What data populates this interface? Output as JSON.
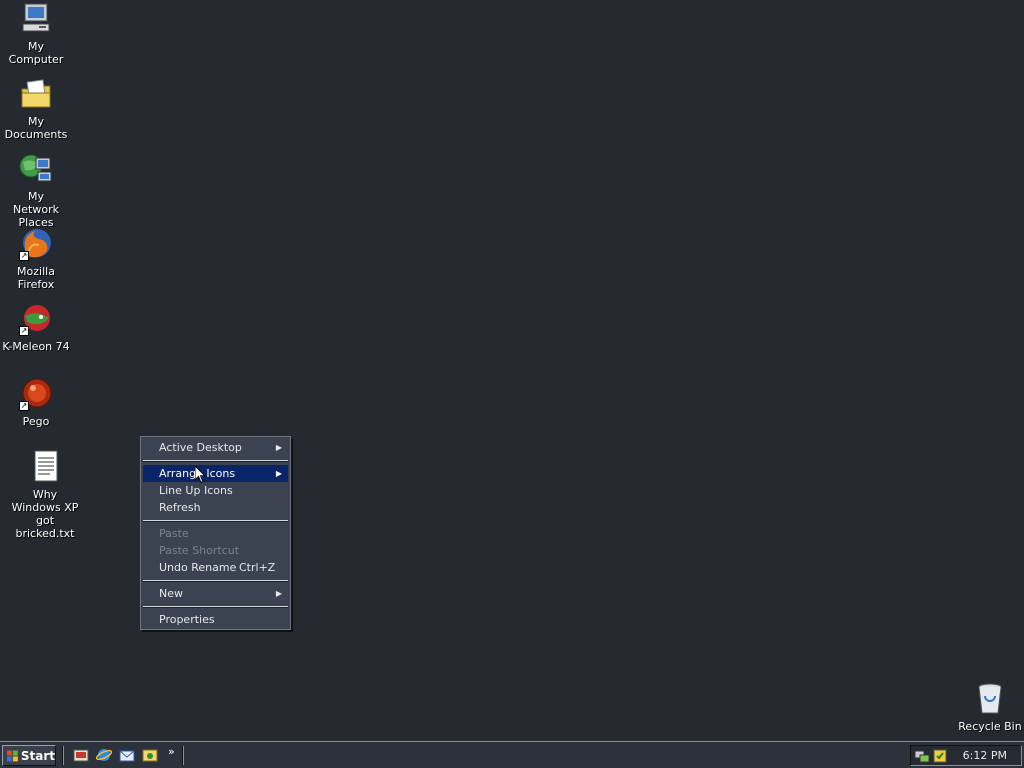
{
  "desktop": {
    "icons": [
      {
        "label": "My Computer",
        "icon": "my-computer-icon"
      },
      {
        "label": "My Documents",
        "icon": "my-documents-icon"
      },
      {
        "label": "My Network Places",
        "icon": "network-places-icon"
      },
      {
        "label": "Mozilla Firefox",
        "icon": "firefox-icon"
      },
      {
        "label": "K-Meleon 74",
        "icon": "k-meleon-icon"
      },
      {
        "label": "Pego",
        "icon": "pego-icon"
      },
      {
        "label": "Why Windows XP got bricked.txt",
        "icon": "text-file-icon"
      },
      {
        "label": "Recycle Bin",
        "icon": "recycle-bin-icon"
      }
    ]
  },
  "context_menu": {
    "items": [
      {
        "label": "Active Desktop",
        "arrow": "▶"
      },
      {
        "label": "Arrange Icons",
        "arrow": "▶",
        "selected": true
      },
      {
        "label": "Line Up Icons"
      },
      {
        "label": "Refresh"
      },
      {
        "label": "Paste",
        "disabled": true
      },
      {
        "label": "Paste Shortcut",
        "disabled": true
      },
      {
        "label": "Undo Rename",
        "shortcut": "Ctrl+Z"
      },
      {
        "label": "New",
        "arrow": "▶"
      },
      {
        "label": "Properties"
      }
    ]
  },
  "taskbar": {
    "start_label": "Start",
    "quick_launch_more": "»",
    "clock": "6:12 PM",
    "quick_launch": [
      "show-desktop-icon",
      "internet-explorer-icon",
      "outlook-express-icon",
      "media-icon"
    ],
    "tray_icons": [
      "network-tray-icon",
      "shield-tray-icon"
    ]
  },
  "colors": {
    "desktop_bg": "#252a31",
    "menu_bg": "#3b4250",
    "menu_selected": "#0a246a",
    "taskbar_bg": "#2c323b"
  }
}
